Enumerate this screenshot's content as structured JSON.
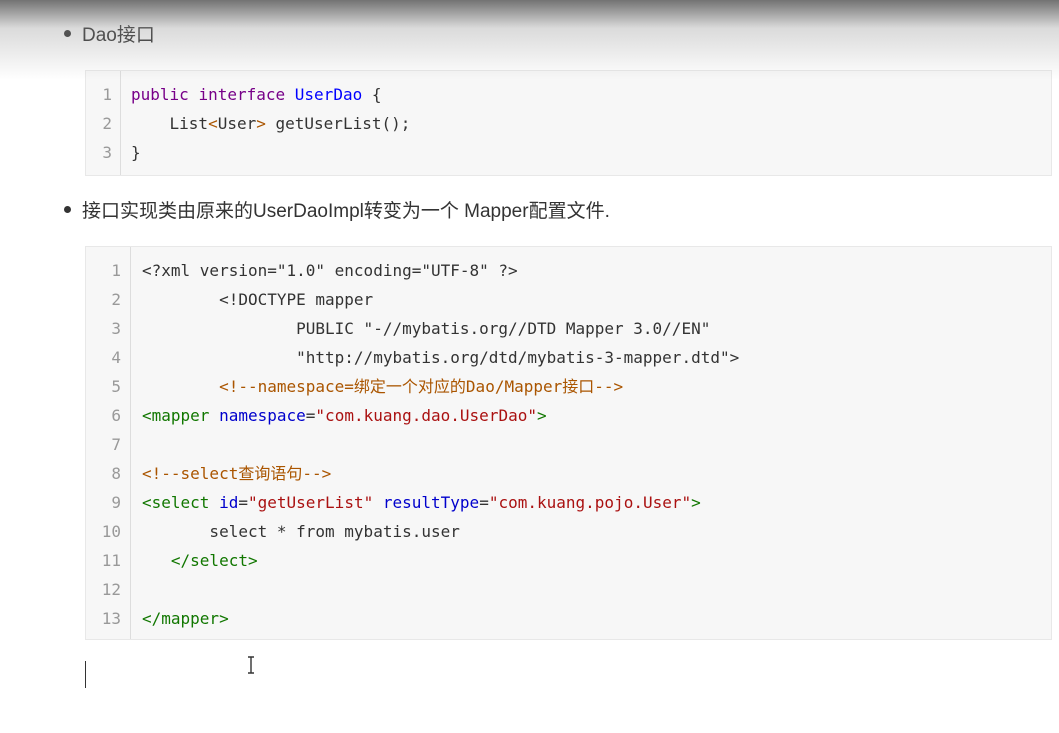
{
  "bullet1": {
    "text": "Dao接口"
  },
  "code1": {
    "lines": [
      {
        "num": "1",
        "tokens": [
          {
            "t": "public",
            "c": "kw"
          },
          {
            "t": " ",
            "c": "plain"
          },
          {
            "t": "interface",
            "c": "kw"
          },
          {
            "t": " ",
            "c": "plain"
          },
          {
            "t": "UserDao",
            "c": "def"
          },
          {
            "t": " {",
            "c": "plain"
          }
        ]
      },
      {
        "num": "2",
        "tokens": [
          {
            "t": "    List",
            "c": "plain"
          },
          {
            "t": "<",
            "c": "cmt"
          },
          {
            "t": "User",
            "c": "plain"
          },
          {
            "t": ">",
            "c": "cmt"
          },
          {
            "t": " getUserList();",
            "c": "plain"
          }
        ]
      },
      {
        "num": "3",
        "tokens": [
          {
            "t": "}",
            "c": "plain"
          }
        ]
      }
    ]
  },
  "bullet2": {
    "text": "接口实现类由原来的UserDaoImpl转变为一个 Mapper配置文件."
  },
  "code2": {
    "lines": [
      {
        "num": "1",
        "tokens": [
          {
            "t": "<?xml version=\"1.0\" encoding=\"UTF-8\" ?>",
            "c": "plain"
          }
        ]
      },
      {
        "num": "2",
        "tokens": [
          {
            "t": "        <!DOCTYPE mapper",
            "c": "plain"
          }
        ]
      },
      {
        "num": "3",
        "tokens": [
          {
            "t": "                PUBLIC \"-//mybatis.org//DTD Mapper 3.0//EN\"",
            "c": "plain"
          }
        ]
      },
      {
        "num": "4",
        "tokens": [
          {
            "t": "                \"http://mybatis.org/dtd/mybatis-3-mapper.dtd\">",
            "c": "plain"
          }
        ]
      },
      {
        "num": "5",
        "tokens": [
          {
            "t": "        <!--namespace=绑定一个对应的Dao/Mapper接口-->",
            "c": "cmt"
          }
        ]
      },
      {
        "num": "6",
        "tokens": [
          {
            "t": "<mapper",
            "c": "tag"
          },
          {
            "t": " ",
            "c": "plain"
          },
          {
            "t": "namespace",
            "c": "attr"
          },
          {
            "t": "=",
            "c": "plain"
          },
          {
            "t": "\"com.kuang.dao.UserDao\"",
            "c": "str"
          },
          {
            "t": ">",
            "c": "tag"
          }
        ]
      },
      {
        "num": "7",
        "tokens": []
      },
      {
        "num": "8",
        "tokens": [
          {
            "t": "<!--select查询语句-->",
            "c": "cmt"
          }
        ]
      },
      {
        "num": "9",
        "tokens": [
          {
            "t": "<select",
            "c": "tag"
          },
          {
            "t": " ",
            "c": "plain"
          },
          {
            "t": "id",
            "c": "attr"
          },
          {
            "t": "=",
            "c": "plain"
          },
          {
            "t": "\"getUserList\"",
            "c": "str"
          },
          {
            "t": " ",
            "c": "plain"
          },
          {
            "t": "resultType",
            "c": "attr"
          },
          {
            "t": "=",
            "c": "plain"
          },
          {
            "t": "\"com.kuang.pojo.User\"",
            "c": "str"
          },
          {
            "t": ">",
            "c": "tag"
          }
        ]
      },
      {
        "num": "10",
        "tokens": [
          {
            "t": "       select * from mybatis.user",
            "c": "plain"
          }
        ]
      },
      {
        "num": "11",
        "tokens": [
          {
            "t": "   </select>",
            "c": "tag"
          }
        ]
      },
      {
        "num": "12",
        "tokens": []
      },
      {
        "num": "13",
        "tokens": [
          {
            "t": "</mapper>",
            "c": "tag"
          }
        ]
      }
    ]
  }
}
